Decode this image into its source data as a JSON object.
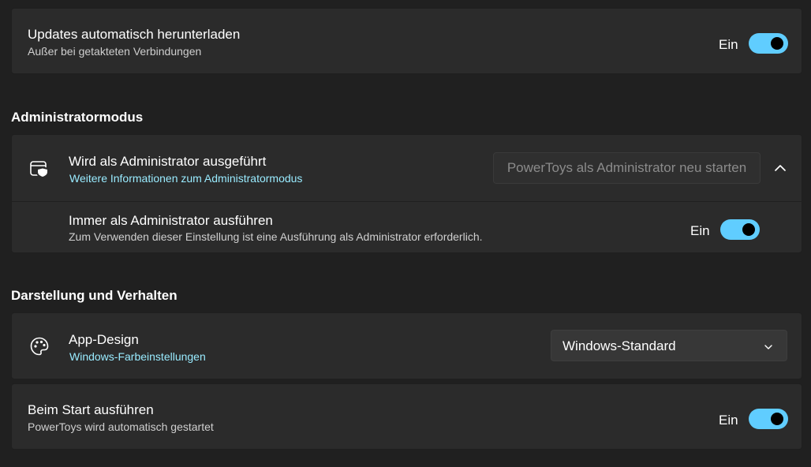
{
  "updates": {
    "title": "Updates automatisch herunterladen",
    "subtitle": "Außer bei getakteten Verbindungen",
    "toggle_label": "Ein",
    "toggle_on": true
  },
  "admin_section": {
    "header": "Administratormodus",
    "running": {
      "title": "Wird als Administrator ausgeführt",
      "link": "Weitere Informationen zum Administratormodus",
      "button_label": "PowerToys als Administrator neu starten",
      "icon": "shield-window-icon",
      "expander_icon": "chevron-up-icon"
    },
    "always": {
      "title": "Immer als Administrator ausführen",
      "subtitle": "Zum Verwenden dieser Einstellung ist eine Ausführung als Administrator erforderlich.",
      "toggle_label": "Ein",
      "toggle_on": true
    }
  },
  "appearance_section": {
    "header": "Darstellung und Verhalten",
    "app_design": {
      "title": "App-Design",
      "link": "Windows-Farbeinstellungen",
      "icon": "palette-icon",
      "selected": "Windows-Standard"
    },
    "startup": {
      "title": "Beim Start ausführen",
      "subtitle": "PowerToys wird automatisch gestartet",
      "toggle_label": "Ein",
      "toggle_on": true
    }
  },
  "colors": {
    "accent": "#60cdff",
    "link": "#99ebff",
    "background": "#202020",
    "card": "#2b2b2b"
  }
}
